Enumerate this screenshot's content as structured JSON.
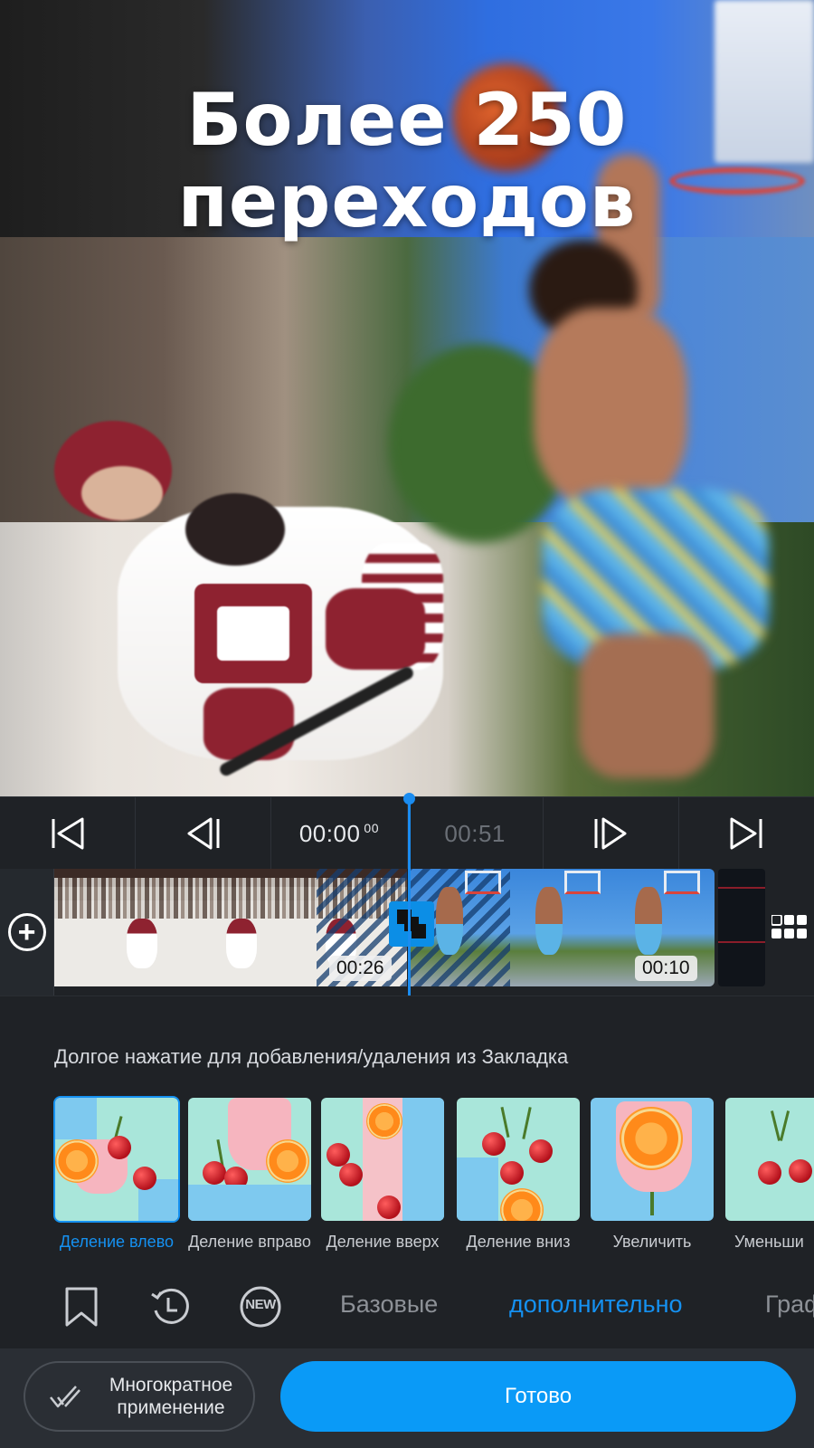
{
  "headline": {
    "line1": "Более 250",
    "line2": "переходов"
  },
  "playback": {
    "current_time": "00:00",
    "current_frames": "00",
    "total_time": "00:51"
  },
  "timeline": {
    "clip1_duration": "00:26",
    "clip2_duration": "00:10"
  },
  "transitions": {
    "hint": "Долгое нажатие для добавления/удаления из Закладка",
    "items": [
      {
        "label": "Деление влево",
        "selected": true
      },
      {
        "label": "Деление вправо",
        "selected": false
      },
      {
        "label": "Деление вверх",
        "selected": false
      },
      {
        "label": "Деление вниз",
        "selected": false
      },
      {
        "label": "Увеличить",
        "selected": false
      },
      {
        "label": "Уменьши",
        "selected": false
      }
    ]
  },
  "tabs": {
    "icons": [
      "bookmark-icon",
      "history-icon",
      "new-icon"
    ],
    "new_badge": "NEW",
    "basic": "Базовые",
    "advanced": "дополнительно",
    "graphic": "Графи"
  },
  "footer": {
    "multi_apply": "Многократное применение",
    "done": "Готово"
  },
  "colors": {
    "accent": "#1591f1",
    "done_button": "#0a9af7",
    "background": "#1f2226"
  }
}
